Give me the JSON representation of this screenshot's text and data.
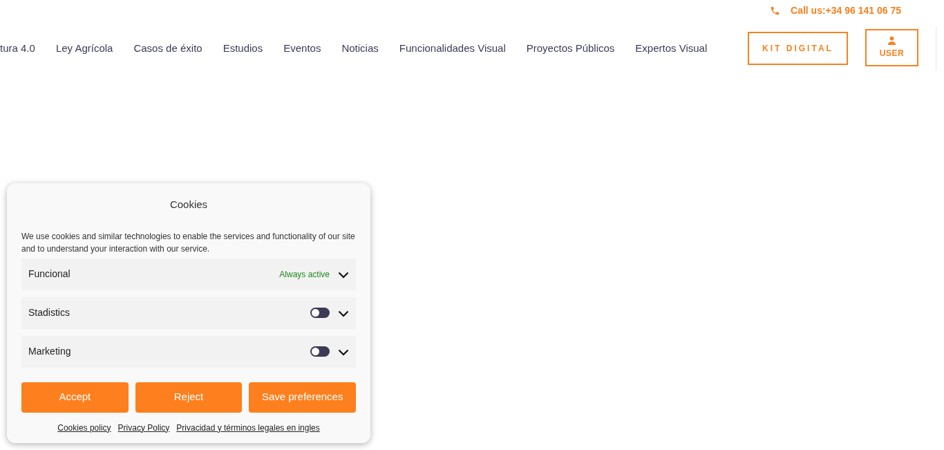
{
  "header": {
    "contact": {
      "label": "Call us:+34 96 141 06 75"
    },
    "nav": [
      {
        "label": "tura 4.0"
      },
      {
        "label": "Ley Agrícola"
      },
      {
        "label": "Casos de éxito"
      },
      {
        "label": "Estudios"
      },
      {
        "label": "Eventos"
      },
      {
        "label": "Noticias"
      },
      {
        "label": "Funcionalidades Visual"
      },
      {
        "label": "Proyectos Públicos"
      },
      {
        "label": "Expertos Visual"
      }
    ],
    "buttons": [
      {
        "kind": "text",
        "label": "KIT DIGITAL"
      },
      {
        "kind": "user",
        "label": "USER"
      }
    ]
  },
  "cookie_banner": {
    "title": "Cookies",
    "description": "We use cookies and similar technologies to enable the services and functionality of our site and to understand your interaction with our service.",
    "categories": [
      {
        "name": "Funcional",
        "kind": "always",
        "status": "Always active",
        "expanded": false
      },
      {
        "name": "Stadistics",
        "kind": "toggle",
        "on": false,
        "expanded": false
      },
      {
        "name": "Marketing",
        "kind": "toggle",
        "on": false,
        "expanded": false
      }
    ],
    "buttons": [
      "Accept",
      "Reject",
      "Save preferences"
    ],
    "links": [
      "Cookies policy",
      "Privacy Policy",
      "Privacidad y términos legales en ingles"
    ]
  }
}
